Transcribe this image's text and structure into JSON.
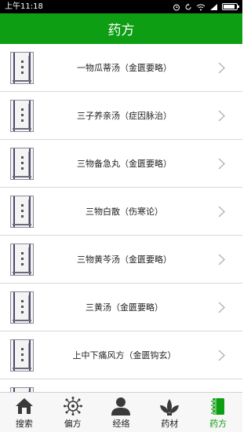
{
  "status_bar": {
    "time": "上午11:18",
    "icons": [
      "alarm-icon",
      "sync-icon",
      "wifi-icon",
      "signal-icon",
      "battery-icon"
    ]
  },
  "header": {
    "title": "药方"
  },
  "list": {
    "items": [
      {
        "title": "一物瓜蒂汤（金匮要略）",
        "icon": "book-cover-thumbnail"
      },
      {
        "title": "三子养亲汤（症因脉治）",
        "icon": "book-cover-thumbnail"
      },
      {
        "title": "三物备急丸（金匮要略）",
        "icon": "book-cover-thumbnail"
      },
      {
        "title": "三物白散（伤寒论）",
        "icon": "book-cover-thumbnail"
      },
      {
        "title": "三物黄芩汤（金匮要略）",
        "icon": "book-cover-thumbnail"
      },
      {
        "title": "三黄汤（金匮要略）",
        "icon": "book-cover-thumbnail"
      },
      {
        "title": "上中下痛风方（金匮钩玄）",
        "icon": "book-cover-thumbnail"
      }
    ]
  },
  "tab_bar": {
    "tabs": [
      {
        "label": "搜索",
        "icon": "home-icon",
        "active": false
      },
      {
        "label": "偏方",
        "icon": "molecule-icon",
        "active": false
      },
      {
        "label": "经络",
        "icon": "person-icon",
        "active": false
      },
      {
        "label": "药材",
        "icon": "plant-icon",
        "active": false
      },
      {
        "label": "药方",
        "icon": "notebook-icon",
        "active": true
      }
    ],
    "active_color": "#0d9e13",
    "inactive_color": "#222222"
  },
  "colors": {
    "header_bg": "#0d9e13",
    "divider": "#d8d8d8"
  }
}
